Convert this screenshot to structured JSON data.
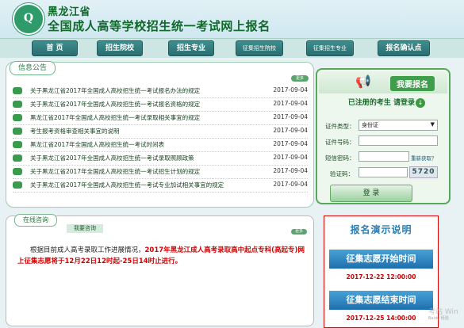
{
  "header": {
    "title1": "黑龙江省",
    "title2": "全国成人高等学校招生统一考试网上报名"
  },
  "nav": {
    "items": [
      "首 页",
      "招生院校",
      "招生专业",
      "征集招生院校",
      "征集招生专业",
      "报名确认点"
    ]
  },
  "info": {
    "tab": "信息公告",
    "more": "更多",
    "rows": [
      {
        "text": "关于黑龙江省2017年全国成人高校招生统一考试报名办法的规定",
        "date": "2017-09-04"
      },
      {
        "text": "关于黑龙江省2017年全国成人高校招生统一考试报名资格的规定",
        "date": "2017-09-04"
      },
      {
        "text": "黑龙江省2017年全国成人高校招生统一考试录取相关事宜的规定",
        "date": "2017-09-04"
      },
      {
        "text": "考生报考资格审查相关事宜的说明",
        "date": "2017-09-04"
      },
      {
        "text": "黑龙江省2017年全国成人高校招生统一考试时间表",
        "date": "2017-09-04"
      },
      {
        "text": "关于黑龙江省2017年全国成人高校招生统一考试录取照顾政策",
        "date": "2017-09-04"
      },
      {
        "text": "关于黑龙江省2017年全国成人高校招生统一考试招生计划的规定",
        "date": "2017-09-04"
      },
      {
        "text": "关于黑龙江省2017年全国成人高校招生统一考试专业加试相关事宜的规定",
        "date": "2017-09-04"
      }
    ]
  },
  "register": {
    "title": "我要报名",
    "subtitle": "已注册的考生 请登录",
    "cert_type_label": "证件类型：",
    "cert_type_value": "身份证",
    "cert_no_label": "证件号码：",
    "sms_label": "短信密码：",
    "resend": "重新获取？",
    "captcha_label": "验证码：",
    "captcha": "5720",
    "login": "登 录"
  },
  "consult": {
    "tab": "在线咨询",
    "tab2": "我要咨询",
    "more": "更多",
    "text_plain": "根据目前成人高考录取工作进展情况，",
    "text_red": "2017年黑龙江成人高考录取高中起点专科(高起专)网上征集志愿将于12月22日12时起-25日14时止进行。"
  },
  "demo": {
    "title": "报名演示说明",
    "start_label": "征集志愿开始时间",
    "start_time": "2017-12-22 12:00:00",
    "end_label": "征集志愿结束时间",
    "end_time": "2017-12-25 14:00:00"
  },
  "watermark": {
    "line1": "考站 Win",
    "line2": "Baidu 经验"
  },
  "colors": {
    "accent": "#3f9d4c",
    "nav": "#2a6d70",
    "alert": "#d40000",
    "demo": "#1e6fad"
  }
}
